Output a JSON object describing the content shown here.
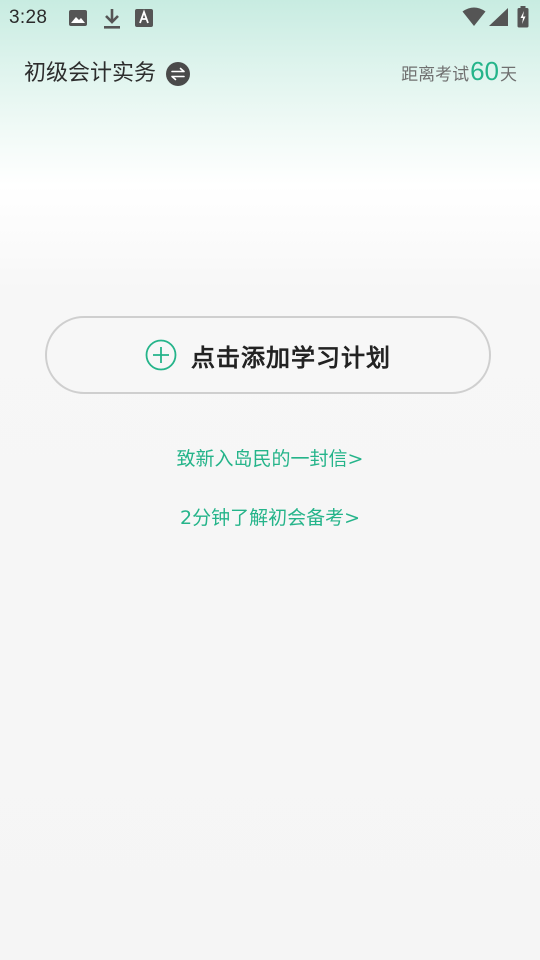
{
  "status_bar": {
    "time": "3:28",
    "left_icons": [
      "image-icon",
      "download-icon",
      "font-icon"
    ],
    "right_icons": [
      "wifi-icon",
      "cellular-signal-icon",
      "battery-icon"
    ]
  },
  "header": {
    "subject": "初级会计实务",
    "switch_icon": "swap-icon",
    "countdown_prefix": "距离考试",
    "countdown_days": "60",
    "countdown_suffix": "天"
  },
  "main": {
    "add_plan_label": "点击添加学习计划",
    "add_plan_icon": "plus-circle-icon",
    "link_letter": "致新入岛民的一封信>",
    "link_intro": "2分钟了解初会备考>"
  },
  "colors": {
    "accent": "#25b48a",
    "text_dark": "#2d2d2d",
    "text_muted": "#707070",
    "border": "#cfcfcf",
    "header_gradient_top": "#c8ece1"
  }
}
